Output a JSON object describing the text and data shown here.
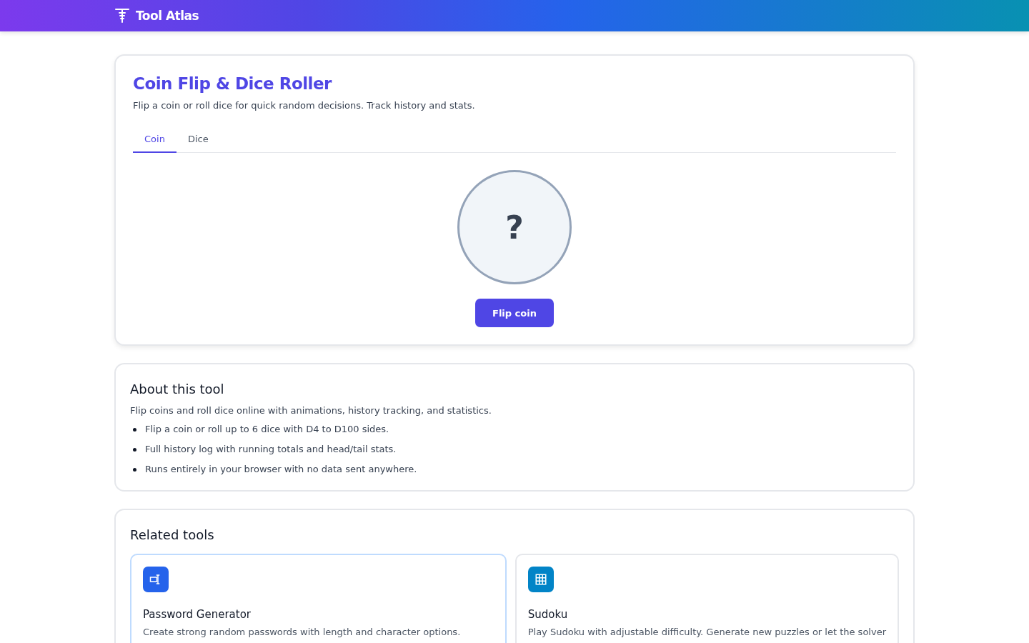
{
  "header": {
    "brand": "Tool Atlas"
  },
  "tool": {
    "title": "Coin Flip & Dice Roller",
    "subtitle": "Flip a coin or roll dice for quick random decisions. Track history and stats.",
    "tabs": [
      {
        "label": "Coin",
        "selected": true
      },
      {
        "label": "Dice",
        "selected": false
      }
    ],
    "coin_face": "?",
    "button": "Flip coin"
  },
  "about": {
    "heading": "About this tool",
    "intro": "Flip coins and roll dice online with animations, history tracking, and statistics.",
    "bullets": [
      "Flip a coin or roll up to 6 dice with D4 to D100 sides.",
      "Full history log with running totals and head/tail stats.",
      "Runs entirely in your browser with no data sent anywhere."
    ]
  },
  "related": {
    "heading": "Related tools",
    "cards": [
      {
        "kind": "password",
        "name": "Password Generator",
        "description": "Create strong random passwords with length and character options.",
        "highlighted": true,
        "color": "#2563eb"
      },
      {
        "kind": "grid",
        "name": "Sudoku",
        "description": "Play Sudoku with adjustable difficulty. Generate new puzzles or let the solver",
        "highlighted": false,
        "color": "#0284c7"
      }
    ]
  }
}
